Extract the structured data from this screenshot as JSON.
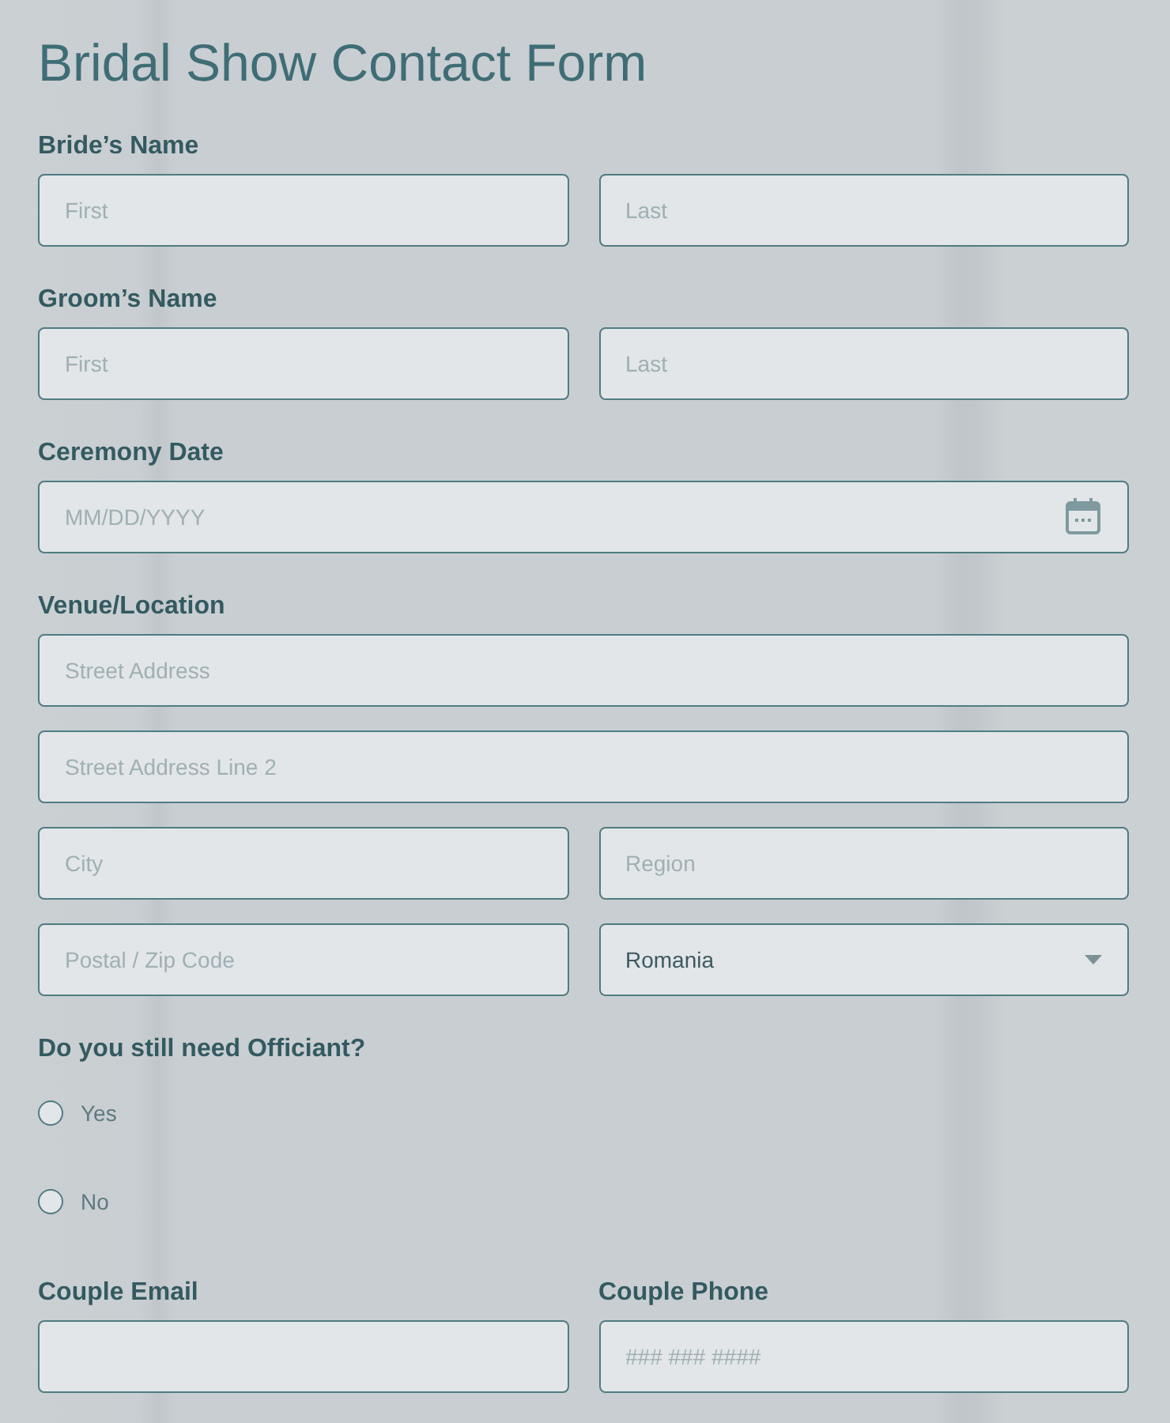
{
  "title": "Bridal Show Contact Form",
  "sections": [
    {
      "kind": "fields",
      "label": "Bride’s Name",
      "rows": [
        [
          {
            "kind": "text",
            "placeholder": "First"
          },
          {
            "kind": "text",
            "placeholder": "Last"
          }
        ]
      ]
    },
    {
      "kind": "fields",
      "label": "Groom’s Name",
      "rows": [
        [
          {
            "kind": "text",
            "placeholder": "First"
          },
          {
            "kind": "text",
            "placeholder": "Last"
          }
        ]
      ]
    },
    {
      "kind": "fields",
      "label": "Ceremony Date",
      "rows": [
        [
          {
            "kind": "date",
            "placeholder": "MM/DD/YYYY"
          }
        ]
      ]
    },
    {
      "kind": "fields",
      "label": "Venue/Location",
      "rows": [
        [
          {
            "kind": "text",
            "placeholder": "Street Address"
          }
        ],
        [
          {
            "kind": "text",
            "placeholder": "Street Address Line 2"
          }
        ],
        [
          {
            "kind": "text",
            "placeholder": "City"
          },
          {
            "kind": "text",
            "placeholder": "Region"
          }
        ],
        [
          {
            "kind": "text",
            "placeholder": "Postal / Zip Code"
          },
          {
            "kind": "select",
            "value": "Romania"
          }
        ]
      ]
    },
    {
      "kind": "radio",
      "label": "Do you still need Officiant?",
      "options": [
        {
          "label": "Yes",
          "selected": false
        },
        {
          "label": "No",
          "selected": false
        }
      ]
    },
    {
      "kind": "columns",
      "columns": [
        {
          "label": "Couple Email",
          "input": {
            "kind": "text"
          }
        },
        {
          "label": "Couple Phone",
          "input": {
            "kind": "text",
            "placeholder": "### ### ####"
          }
        }
      ]
    }
  ]
}
